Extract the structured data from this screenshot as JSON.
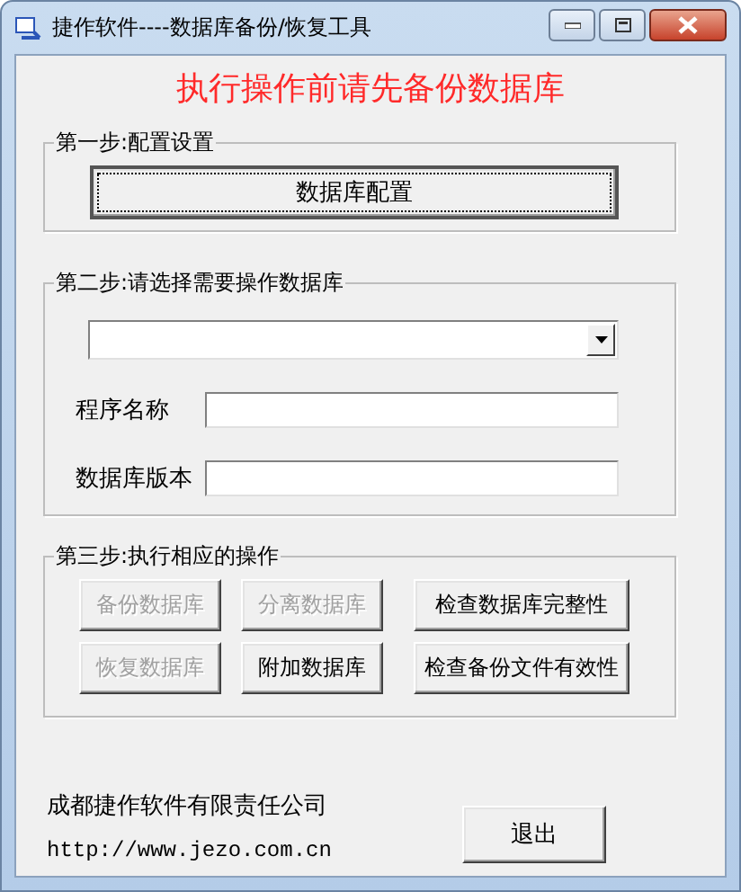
{
  "window": {
    "title": "捷作软件----数据库备份/恢复工具"
  },
  "warning": "执行操作前请先备份数据库",
  "step1": {
    "legend": "第一步:配置设置",
    "button": "数据库配置"
  },
  "step2": {
    "legend": "第二步:请选择需要操作数据库",
    "fields": [
      {
        "label": "程序名称"
      },
      {
        "label": "数据库版本"
      }
    ]
  },
  "step3": {
    "legend": "第三步:执行相应的操作",
    "buttons": [
      {
        "label": "备份数据库",
        "disabled": true
      },
      {
        "label": "分离数据库",
        "disabled": true
      },
      {
        "label": "检查数据库完整性",
        "disabled": false
      },
      {
        "label": "恢复数据库",
        "disabled": true
      },
      {
        "label": "附加数据库",
        "disabled": false
      },
      {
        "label": "检查备份文件有效性",
        "disabled": false
      }
    ]
  },
  "footer": {
    "company": "成都捷作软件有限责任公司",
    "url": "http://www.jezo.com.cn",
    "exit_button": "退出"
  }
}
